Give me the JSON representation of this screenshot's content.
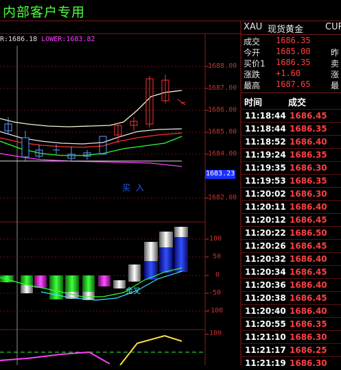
{
  "window": {
    "title": "内部客户专用"
  },
  "chart": {
    "info_mid": "R:1686.18",
    "info_lower_label": "LOWER:1683.82",
    "price_ticks": [
      "1688.00",
      "1687.00",
      "1686.00",
      "1685.00",
      "1684.00",
      "1683.23",
      "1682.00"
    ],
    "current_price": "1683.23",
    "signal_text": "买 入",
    "osc_ticks": [
      "100",
      "50",
      "0",
      "-50",
      "-100"
    ],
    "osc_label": "金叉",
    "bottom_ticks": [
      "100"
    ]
  },
  "quote": {
    "symbol": "XAU",
    "name": "现货黄金",
    "name_cut": "CUR",
    "rows": [
      {
        "label": "成交",
        "value": "1686.35",
        "cut": ""
      },
      {
        "label": "今开",
        "value": "1685.00",
        "cut": "昨"
      },
      {
        "label": "买价1",
        "value": "1686.35",
        "cut": "卖"
      },
      {
        "label": "涨跌",
        "value": "+1.60",
        "cut": "涨"
      },
      {
        "label": "最高",
        "value": "1687.65",
        "cut": "最"
      }
    ]
  },
  "ticks": {
    "headers": {
      "time": "时间",
      "price": "成交"
    },
    "rows": [
      {
        "time": "11:18:44",
        "price": "1686.45"
      },
      {
        "time": "11:18:44",
        "price": "1686.35"
      },
      {
        "time": "11:18:52",
        "price": "1686.40"
      },
      {
        "time": "11:19:24",
        "price": "1686.35"
      },
      {
        "time": "11:19:35",
        "price": "1686.30"
      },
      {
        "time": "11:19:53",
        "price": "1686.35"
      },
      {
        "time": "11:20:02",
        "price": "1686.30"
      },
      {
        "time": "11:20:11",
        "price": "1686.40"
      },
      {
        "time": "11:20:12",
        "price": "1686.45"
      },
      {
        "time": "11:20:22",
        "price": "1686.50"
      },
      {
        "time": "11:20:26",
        "price": "1686.45"
      },
      {
        "time": "11:20:32",
        "price": "1686.40"
      },
      {
        "time": "11:20:34",
        "price": "1686.45"
      },
      {
        "time": "11:20:36",
        "price": "1686.40"
      },
      {
        "time": "11:20:38",
        "price": "1686.45"
      },
      {
        "time": "11:20:40",
        "price": "1686.40"
      },
      {
        "time": "11:20:55",
        "price": "1686.35"
      },
      {
        "time": "11:21:10",
        "price": "1686.30"
      },
      {
        "time": "11:21:17",
        "price": "1686.25"
      },
      {
        "time": "11:21:19",
        "price": "1686.30"
      }
    ]
  },
  "colors": {
    "title_green": "#4cff3c",
    "axis_red": "#cc3030",
    "price_red": "#ff4040",
    "lower_magenta": "#ff40ff",
    "label_blue": "#2060ff"
  }
}
